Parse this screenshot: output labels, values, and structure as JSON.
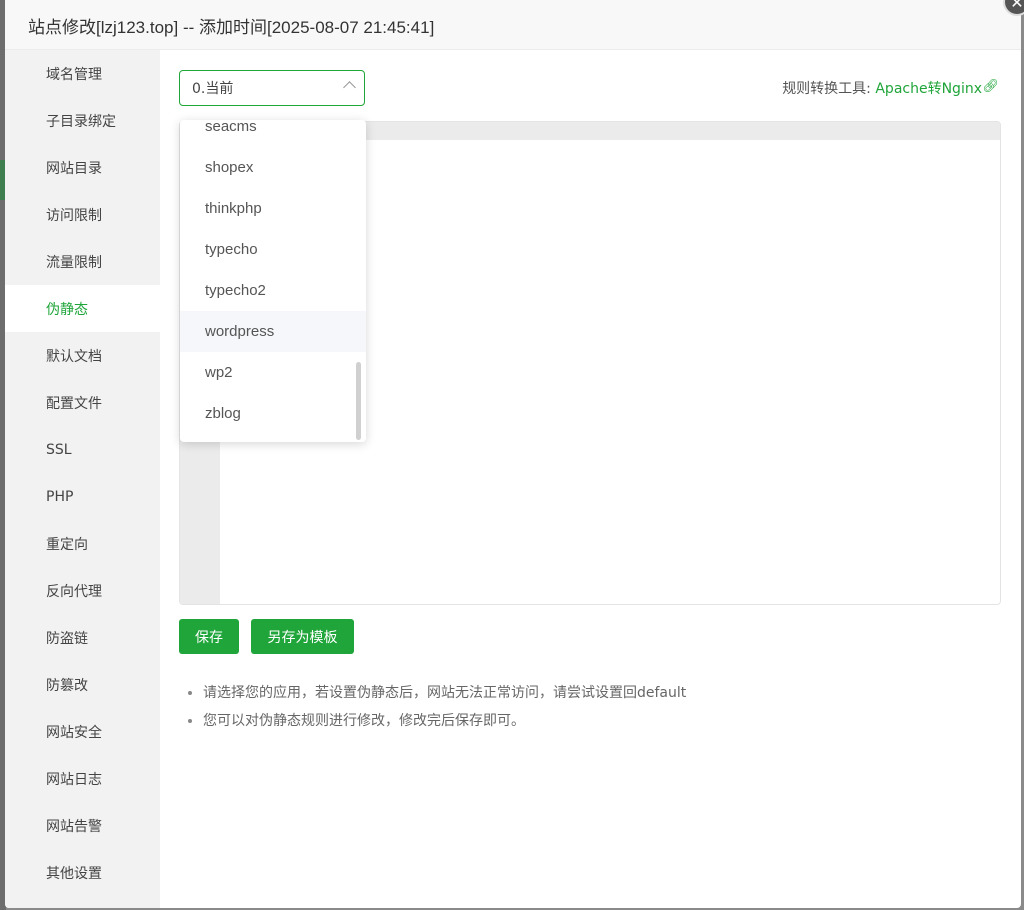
{
  "dialog": {
    "title": "站点修改[lzj123.top] -- 添加时间[2025-08-07 21:45:41]",
    "close_icon": "✕"
  },
  "sidebar": {
    "items": [
      {
        "label": "域名管理"
      },
      {
        "label": "子目录绑定"
      },
      {
        "label": "网站目录"
      },
      {
        "label": "访问限制"
      },
      {
        "label": "流量限制"
      },
      {
        "label": "伪静态",
        "active": true
      },
      {
        "label": "默认文档"
      },
      {
        "label": "配置文件"
      },
      {
        "label": "SSL"
      },
      {
        "label": "PHP"
      },
      {
        "label": "重定向"
      },
      {
        "label": "反向代理"
      },
      {
        "label": "防盗链"
      },
      {
        "label": "防篡改"
      },
      {
        "label": "网站安全"
      },
      {
        "label": "网站日志"
      },
      {
        "label": "网站告警"
      },
      {
        "label": "其他设置"
      }
    ]
  },
  "rewrite": {
    "selected": "0.当前",
    "options": [
      "seacms",
      "shopex",
      "thinkphp",
      "typecho",
      "typecho2",
      "wordpress",
      "wp2",
      "zblog"
    ],
    "hovered_option": "wordpress",
    "tool_label": "规则转换工具:",
    "tool_link": "Apache转Nginx",
    "tool_icon": "link-icon"
  },
  "actions": {
    "save_label": "保存",
    "save_template_label": "另存为模板"
  },
  "tips": [
    "请选择您的应用，若设置伪静态后，网站无法正常访问，请尝试设置回default",
    "您可以对伪静态规则进行修改，修改完后保存即可。"
  ],
  "colors": {
    "accent": "#20a53a",
    "sidebar_bg": "#f2f2f2"
  }
}
